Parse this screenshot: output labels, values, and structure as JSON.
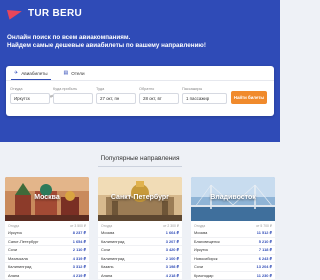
{
  "brand": {
    "name": "TUR BERU",
    "accent": "#2f4bb7",
    "logo_color": "#e8465b",
    "cta_color": "#f08a2c"
  },
  "tagline": {
    "line1": "Онлайн поиск по всем авиакомпаниям.",
    "line2": "Найдем самые дешевые авиабилеты по вашему направлению!"
  },
  "search": {
    "tabs": [
      {
        "label": "Авиабилеты",
        "icon": "plane-icon",
        "active": true
      },
      {
        "label": "Отели",
        "icon": "hotel-icon",
        "active": false
      }
    ],
    "from": {
      "label": "Откуда",
      "value": "Иркутск"
    },
    "to": {
      "label": "Куда прибыть",
      "value": ""
    },
    "depart": {
      "label": "Туда",
      "value": "27 окт, пн"
    },
    "return": {
      "label": "Обратно",
      "value": "28 окт, вт"
    },
    "passengers": {
      "label": "Пассажиры",
      "value": "1 пассажир"
    },
    "submit_label": "Найти билеты"
  },
  "popular": {
    "title": "Популярные направления",
    "cities": [
      {
        "name": "Москва",
        "header_dest": "Откуда",
        "header_price": "от 3 500 ₽",
        "rows": [
          {
            "dest": "Иркутск",
            "price": "8 237 ₽"
          },
          {
            "dest": "Санкт-Петербург",
            "price": "1 654 ₽"
          },
          {
            "dest": "Сочи",
            "price": "2 110 ₽"
          },
          {
            "dest": "Махачкала",
            "price": "4 319 ₽"
          },
          {
            "dest": "Калининград",
            "price": "3 312 ₽"
          },
          {
            "dest": "Анапа",
            "price": "4 219 ₽"
          }
        ]
      },
      {
        "name": "Санкт-Петербург",
        "header_dest": "Откуда",
        "header_price": "от 2 300 ₽",
        "rows": [
          {
            "dest": "Москва",
            "price": "1 664 ₽"
          },
          {
            "dest": "Калининград",
            "price": "3 207 ₽"
          },
          {
            "dest": "Сочи",
            "price": "3 420 ₽"
          },
          {
            "dest": "Калининград",
            "price": "2 100 ₽"
          },
          {
            "dest": "Казань",
            "price": "3 198 ₽"
          },
          {
            "dest": "Анапа",
            "price": "4 218 ₽"
          }
        ]
      },
      {
        "name": "Владивосток",
        "header_dest": "Откуда",
        "header_price": "от 5 700 ₽",
        "rows": [
          {
            "dest": "Москва",
            "price": "11 512 ₽"
          },
          {
            "dest": "Благовещенск",
            "price": "5 210 ₽"
          },
          {
            "dest": "Иркутск",
            "price": "7 118 ₽"
          },
          {
            "dest": "Новосибирск",
            "price": "6 243 ₽"
          },
          {
            "dest": "Сочи",
            "price": "13 204 ₽"
          },
          {
            "dest": "Краснодар",
            "price": "11 230 ₽"
          }
        ]
      }
    ]
  }
}
